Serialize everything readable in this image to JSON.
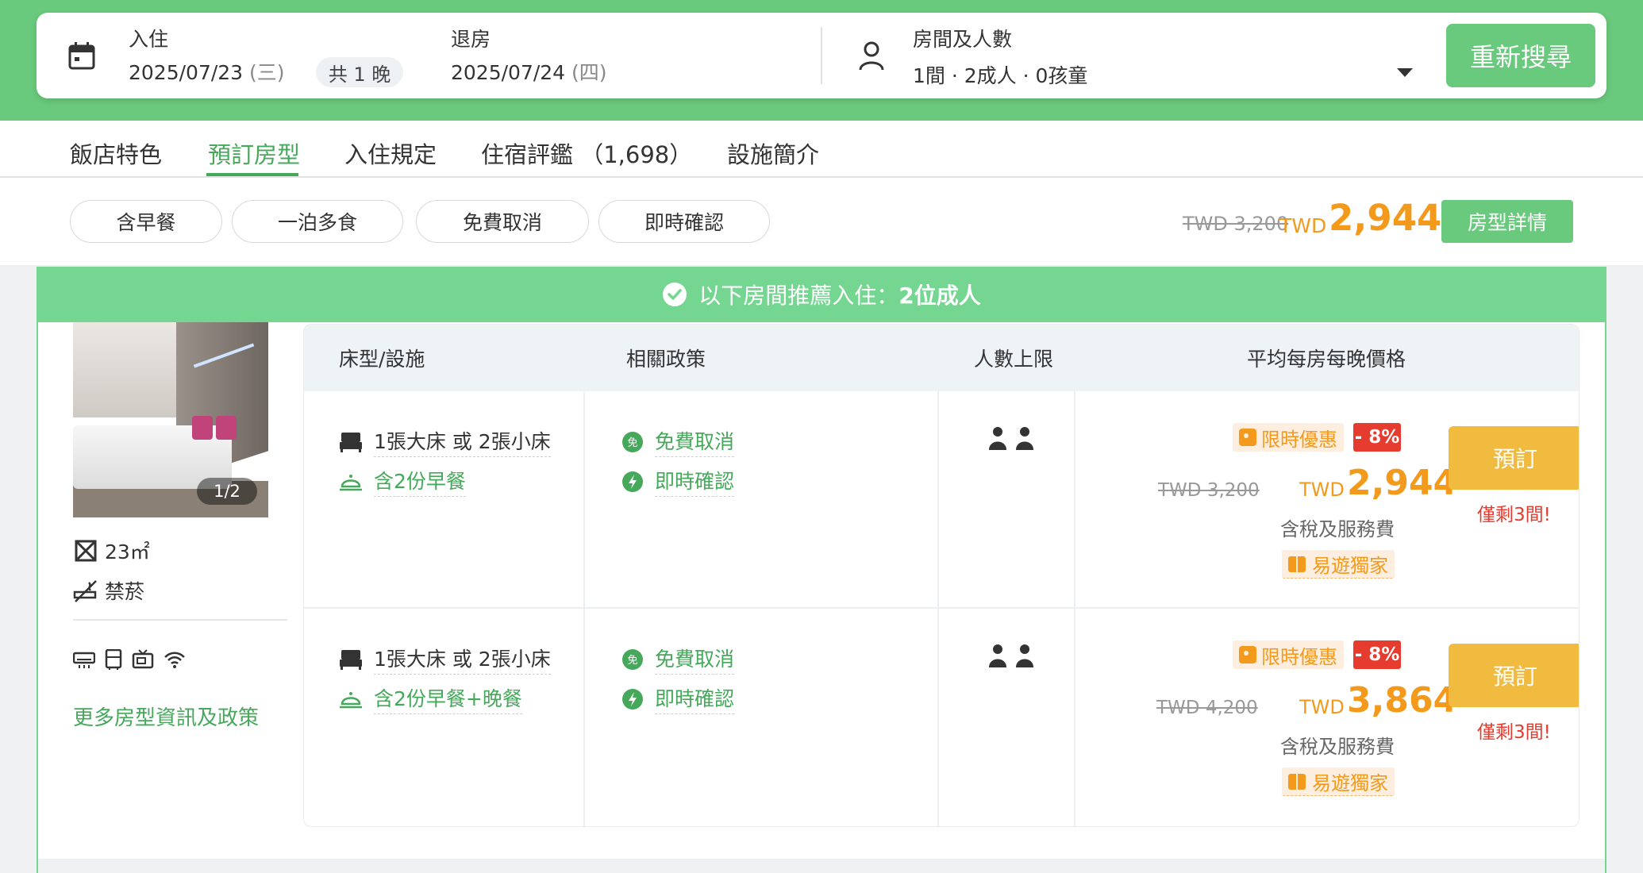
{
  "search": {
    "checkin_label": "入住",
    "checkin_date": "2025/07/23",
    "checkin_dow": "(三)",
    "nights": "共 1 晚",
    "checkout_label": "退房",
    "checkout_date": "2025/07/24",
    "checkout_dow": "(四)",
    "guests_label": "房間及人數",
    "guests_value": "1間 · 2成人 · 0孩童",
    "research_button": "重新搜尋"
  },
  "tabs": [
    {
      "label": "飯店特色",
      "active": false
    },
    {
      "label": "預訂房型",
      "active": true
    },
    {
      "label": "入住規定",
      "active": false
    },
    {
      "label": "住宿評鑑 （1,698）",
      "active": false
    },
    {
      "label": "設施簡介",
      "active": false
    }
  ],
  "filters": [
    "含早餐",
    "一泊多食",
    "免費取消",
    "即時確認"
  ],
  "summary": {
    "original_price": "TWD 3,200",
    "currency": "TWD",
    "price": "2,944",
    "detail_button": "房型詳情"
  },
  "recommendation": {
    "prefix": "以下房間推薦入住：",
    "guests": "2位成人"
  },
  "room": {
    "photo_counter": "1/2",
    "size": "23㎡",
    "smoking": "禁菸",
    "amenity_icons": [
      "air-conditioner-icon",
      "fridge-icon",
      "tv-icon",
      "wifi-icon"
    ],
    "more_link": "更多房型資訊及政策"
  },
  "table": {
    "headers": {
      "bed": "床型/設施",
      "policy": "相關政策",
      "occupancy": "人數上限",
      "price": "平均每房每晚價格"
    },
    "rates": [
      {
        "bed": "1張大床 或 2張小床",
        "meal": "含2份早餐",
        "cancel": "免費取消",
        "confirm": "即時確認",
        "occupancy": 2,
        "promo": "限時優惠",
        "discount": "- 8%",
        "original_price": "TWD 3,200",
        "currency": "TWD",
        "price": "2,944",
        "tax_note": "含稅及服務費",
        "exclusive": "易遊獨家",
        "book_button": "預訂",
        "rooms_left": "僅剩3間!"
      },
      {
        "bed": "1張大床 或 2張小床",
        "meal": "含2份早餐+晚餐",
        "cancel": "免費取消",
        "confirm": "即時確認",
        "occupancy": 2,
        "promo": "限時優惠",
        "discount": "- 8%",
        "original_price": "TWD 4,200",
        "currency": "TWD",
        "price": "3,864",
        "tax_note": "含稅及服務費",
        "exclusive": "易遊獨家",
        "book_button": "預訂",
        "rooms_left": "僅剩3間!"
      }
    ]
  },
  "colors": {
    "brand_green": "#69c97c",
    "banner_green": "#74d690",
    "link_green": "#46a85b",
    "price_orange": "#f39a1c",
    "book_yellow": "#f0bb3f",
    "alert_red": "#e63c2f"
  }
}
